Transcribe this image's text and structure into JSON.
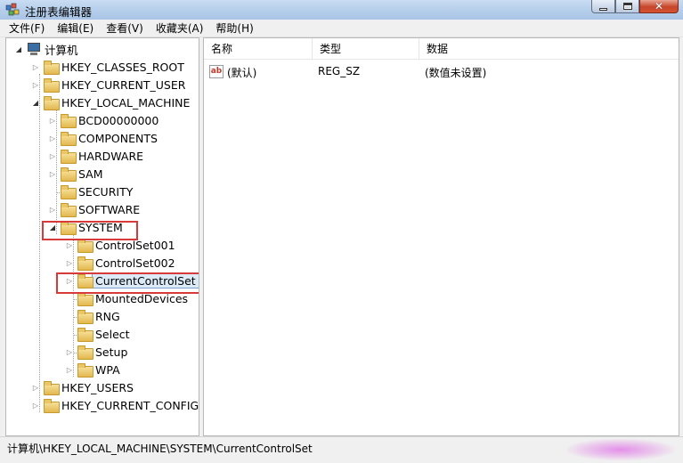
{
  "window": {
    "title": "注册表编辑器",
    "close_glyph": "✕"
  },
  "menu": [
    "文件(F)",
    "编辑(E)",
    "查看(V)",
    "收藏夹(A)",
    "帮助(H)"
  ],
  "tree": {
    "root": "计算机",
    "nodes": [
      {
        "label": "HKEY_CLASSES_ROOT"
      },
      {
        "label": "HKEY_CURRENT_USER"
      },
      {
        "label": "HKEY_LOCAL_MACHINE"
      },
      {
        "label": "BCD00000000"
      },
      {
        "label": "COMPONENTS"
      },
      {
        "label": "HARDWARE"
      },
      {
        "label": "SAM"
      },
      {
        "label": "SECURITY"
      },
      {
        "label": "SOFTWARE"
      },
      {
        "label": "SYSTEM"
      },
      {
        "label": "ControlSet001"
      },
      {
        "label": "ControlSet002"
      },
      {
        "label": "CurrentControlSet"
      },
      {
        "label": "MountedDevices"
      },
      {
        "label": "RNG"
      },
      {
        "label": "Select"
      },
      {
        "label": "Setup"
      },
      {
        "label": "WPA"
      },
      {
        "label": "HKEY_USERS"
      },
      {
        "label": "HKEY_CURRENT_CONFIG"
      }
    ]
  },
  "list": {
    "columns": [
      "名称",
      "类型",
      "数据"
    ],
    "rows": [
      {
        "name": "(默认)",
        "type": "REG_SZ",
        "data": "(数值未设置)",
        "icon_text": "ab"
      }
    ]
  },
  "status": {
    "path": "计算机\\HKEY_LOCAL_MACHINE\\SYSTEM\\CurrentControlSet"
  },
  "colors": {
    "highlight_box": "#d83a3a",
    "title_bar": "#b4cdea",
    "selection": "#dceaf8"
  }
}
